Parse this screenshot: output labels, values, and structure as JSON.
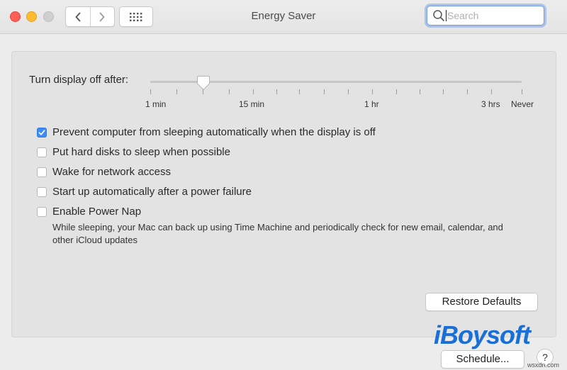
{
  "window": {
    "title": "Energy Saver"
  },
  "search": {
    "placeholder": "Search",
    "value": ""
  },
  "slider": {
    "label": "Turn display off after:",
    "ticks": [
      "1 min",
      "15 min",
      "1 hr",
      "3 hrs",
      "Never"
    ],
    "current_value": "3 min"
  },
  "options": [
    {
      "label": "Prevent computer from sleeping automatically when the display is off",
      "checked": true
    },
    {
      "label": "Put hard disks to sleep when possible",
      "checked": false
    },
    {
      "label": "Wake for network access",
      "checked": false
    },
    {
      "label": "Start up automatically after a power failure",
      "checked": false
    },
    {
      "label": "Enable Power Nap",
      "checked": false
    }
  ],
  "power_nap_note": "While sleeping, your Mac can back up using Time Machine and periodically check for new email, calendar, and other iCloud updates",
  "buttons": {
    "restore_defaults": "Restore Defaults",
    "schedule": "Schedule...",
    "help": "?"
  },
  "watermark": {
    "logo_text": "iBoysoft",
    "credit_text": "wsxdn.com"
  },
  "colors": {
    "accent": "#3d8bf5",
    "close": "#fe5f57",
    "minimize": "#febc2e",
    "watermark": "#1a6fd6"
  },
  "icons": [
    "close-light",
    "minimize-light",
    "zoom-light",
    "back-chevron-icon",
    "forward-chevron-icon",
    "grid-icon",
    "search-icon",
    "checkmark-icon"
  ]
}
